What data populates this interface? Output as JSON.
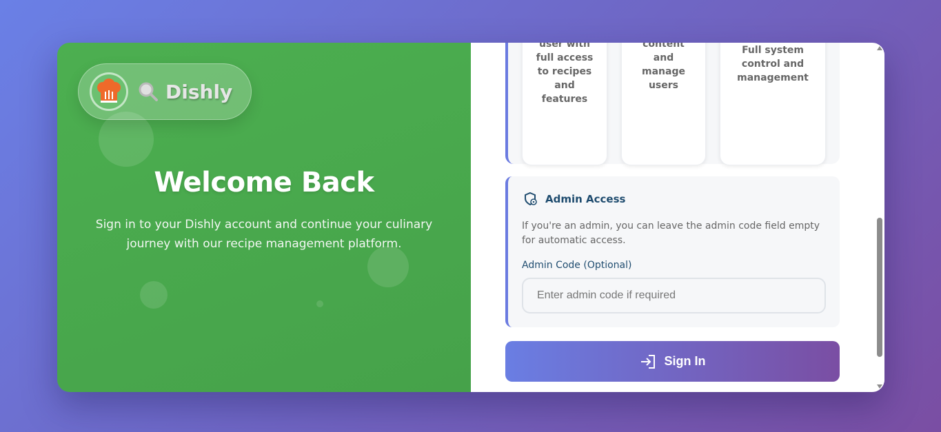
{
  "brand": {
    "name": "Dishly",
    "logo_icon": "chef-hat-icon",
    "search_icon": "search-icon"
  },
  "hero": {
    "title": "Welcome Back",
    "subtitle": "Sign in to your Dishly account and continue your culinary journey with our recipe management platform."
  },
  "roles": [
    {
      "description": "user with full access to recipes and features"
    },
    {
      "description": "content and manage users"
    },
    {
      "description": "Full system control and management"
    }
  ],
  "admin": {
    "title": "Admin Access",
    "icon": "shield-icon",
    "description": "If you're an admin, you can leave the admin code field empty for automatic access.",
    "code_label": "Admin Code (Optional)",
    "code_placeholder": "Enter admin code if required",
    "code_value": ""
  },
  "signin": {
    "label": "Sign In",
    "icon": "sign-in-icon"
  },
  "colors": {
    "left_panel": "#4caf50",
    "accent": "#6a7ae0",
    "button_start": "#6a7ee3",
    "button_end": "#7a4ea3",
    "heading_blue": "#1f4c6f",
    "logo_orange": "#ef6a2a"
  }
}
